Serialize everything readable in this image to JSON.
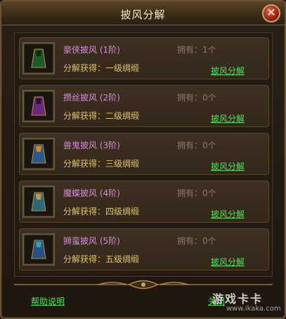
{
  "window": {
    "title": "披风分解",
    "close_glyph": "✕"
  },
  "items": [
    {
      "name": "豪侠披风 (1阶)",
      "owned": "拥有：1个",
      "yield": "分解获得：一级绸缎",
      "action": "披风分解",
      "icon": "cape-icon-green",
      "cape_colors": [
        "#1f5a2b",
        "#0e2b12"
      ]
    },
    {
      "name": "攒丝披风 (2阶)",
      "owned": "拥有：0个",
      "yield": "分解获得：二级绸缎",
      "action": "披风分解",
      "icon": "cape-icon-purple",
      "cape_colors": [
        "#6a2b7a",
        "#2a0f34"
      ]
    },
    {
      "name": "兽鬼披风 (3阶)",
      "owned": "拥有：0个",
      "yield": "分解获得：三级绸缎",
      "action": "披风分解",
      "icon": "cape-icon-blue",
      "cape_colors": [
        "#2b5a8a",
        "#0e2334"
      ]
    },
    {
      "name": "魔蝶披风 (4阶)",
      "owned": "拥有：0个",
      "yield": "分解获得：四级绸缎",
      "action": "披风分解",
      "icon": "cape-icon-teal",
      "cape_colors": [
        "#2b6a7a",
        "#0e2b34"
      ]
    },
    {
      "name": "狮蛮披风 (5阶)",
      "owned": "拥有：0个",
      "yield": "分解获得：五级绸缎",
      "action": "披风分解",
      "icon": "cape-icon-blue-gold",
      "cape_colors": [
        "#2a4f86",
        "#102036"
      ]
    }
  ],
  "footer": {
    "help_label": "帮助说明",
    "ok_label": "关闭"
  },
  "watermark": {
    "main": "游戏卡卡",
    "sub": "www.ikaka.com"
  },
  "colors": {
    "item_name": "#d68ad7",
    "owned": "#8a7a62",
    "yield": "#e2c268",
    "link": "#4ee35a"
  }
}
